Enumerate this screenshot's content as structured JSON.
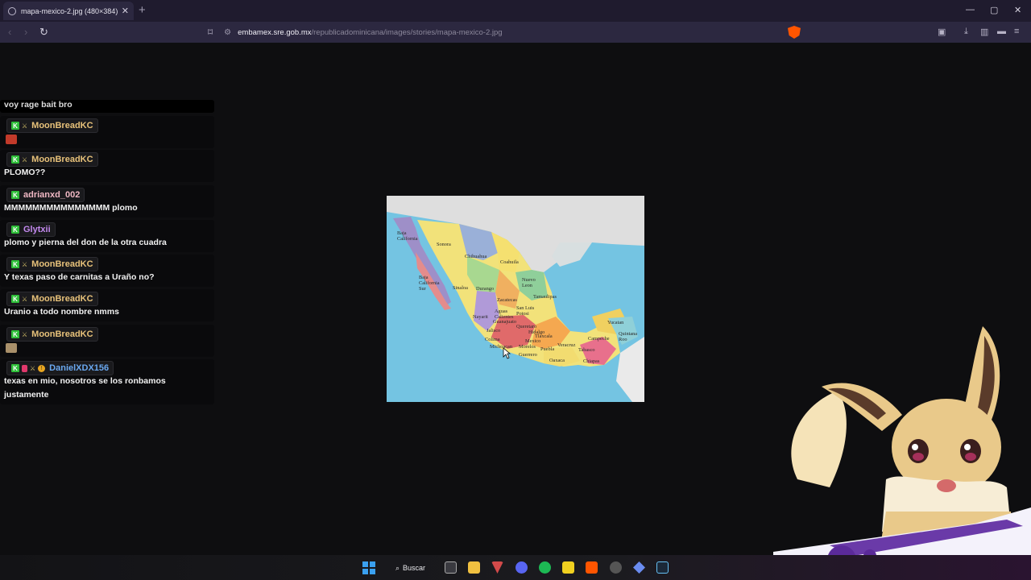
{
  "browser": {
    "tab_title": "mapa-mexico-2.jpg (480×384)",
    "tab_close": "✕",
    "new_tab": "+",
    "url_host": "embamex.sre.gob.mx",
    "url_path": "/republicadominicana/images/stories/mapa-mexico-2.jpg",
    "window_controls": [
      "—",
      "▢",
      "✕"
    ]
  },
  "chat": {
    "top_cut_text": "voy rage bait bro",
    "messages": [
      {
        "user": "MoonBreadKC",
        "color": "#e8c27a",
        "badges": [
          "k",
          "sword"
        ],
        "text": "",
        "emote": "#c23a2a"
      },
      {
        "user": "MoonBreadKC",
        "color": "#e8c27a",
        "badges": [
          "k",
          "sword"
        ],
        "text": "PLOMO??"
      },
      {
        "user": "adrianxd_002",
        "color": "#f0b8c4",
        "badges": [
          "k"
        ],
        "text": "MMMMMMMMMMMMMMM plomo"
      },
      {
        "user": "Glytxii",
        "color": "#c48af0",
        "badges": [
          "k"
        ],
        "text": "plomo y pierna del don de la otra cuadra"
      },
      {
        "user": "MoonBreadKC",
        "color": "#e8c27a",
        "badges": [
          "k",
          "sword"
        ],
        "text": "Y texas paso de carnitas a Uraño no?"
      },
      {
        "user": "MoonBreadKC",
        "color": "#e8c27a",
        "badges": [
          "k",
          "sword"
        ],
        "text": "Uranio a todo nombre nmms"
      },
      {
        "user": "MoonBreadKC",
        "color": "#e8c27a",
        "badges": [
          "k",
          "sword"
        ],
        "text": "",
        "emote": "#a9906a"
      },
      {
        "user": "DanielXDX156",
        "color": "#6aa8f0",
        "badges": [
          "k",
          "r",
          "sword",
          "coin"
        ],
        "text": "texas en mio, nosotros se los ronbamos justamente"
      }
    ]
  },
  "map": {
    "labels": {
      "baja_california": "Baja\nCalifornia",
      "sonora": "Sonora",
      "chihuahua": "Chihuahua",
      "coahuila": "Coahuila",
      "baja_california_sur": "Baja\nCalifornia\nSur",
      "sinaloa": "Sinaloa",
      "durango": "Durango",
      "nuevo_leon": "Nuevo\nLeon",
      "tamaulipas": "Tamaulipas",
      "zacatecas": "Zacatecas",
      "san_luis_potosi": "San Luis\nPotosi",
      "aguas_calientes": "Aguas\nCalientes",
      "nayarit": "Nayarit",
      "guanajuato": "Guanajuato",
      "queretaro": "Queretaro",
      "hidalgo": "Hidalgo",
      "jalisco": "Jalisco",
      "tlaxcala": "Tlaxcala",
      "mexico": "Mexico",
      "colima": "Colima",
      "michoacan": "Michoacan",
      "morelos": "Morelos",
      "puebla": "Puebla",
      "veracruz": "Veracruz",
      "guerrero": "Guerrero",
      "oaxaca": "Oaxaca",
      "tabasco": "Tabasco",
      "campeche": "Campeche",
      "yucatan": "Yucatan",
      "quintana_roo": "Quintana\nRoo",
      "chiapas": "Chiapas"
    }
  },
  "taskbar": {
    "search_label": "Buscar"
  }
}
